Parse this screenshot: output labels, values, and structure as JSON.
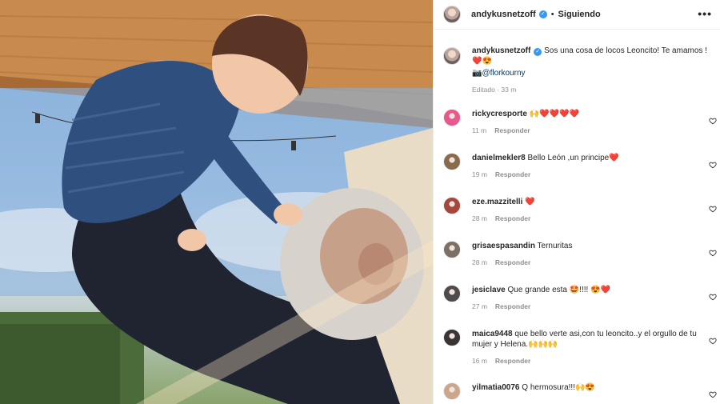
{
  "post": {
    "username": "andykusnetzoff",
    "separator": "•",
    "follow_status": "Siguiendo",
    "more_label": "•••",
    "caption_text": "Sos una cosa de locos Leoncito! Te amamos ! ❤️😍",
    "caption_credit": "📷@flor",
    "caption_credit_mention": "kourny",
    "caption_meta": "Editado · 33 m"
  },
  "comments": [
    {
      "user": "rickycresporte",
      "text": "🙌❤️❤️❤️❤️",
      "time": "11 m",
      "reply": "Responder",
      "avatar_color": "#e7588c"
    },
    {
      "user": "danielmekler8",
      "text": "Bello León ,un principe❤️",
      "time": "19 m",
      "reply": "Responder",
      "avatar_color": "#8a6a4d"
    },
    {
      "user": "eze.mazzitelli",
      "text": "❤️",
      "time": "28 m",
      "reply": "Responder",
      "avatar_color": "#a5473a"
    },
    {
      "user": "grisaespasandin",
      "text": "Ternuritas",
      "time": "28 m",
      "reply": "Responder",
      "avatar_color": "#7c6f66"
    },
    {
      "user": "jesiclave",
      "text": "Que grande esta 🤩!!!! 😍❤️",
      "time": "27 m",
      "reply": "Responder",
      "avatar_color": "#4f4a4c"
    },
    {
      "user": "maica9448",
      "text": "que bello verte asi,con tu leoncito..y el orgullo de tu mujer y Helena.🙌🙌🙌",
      "time": "16 m",
      "reply": "Responder",
      "avatar_color": "#3a3434"
    },
    {
      "user": "yilmatia0076",
      "text": "Q hermosura!!!🙌😍",
      "time": "",
      "reply": "",
      "avatar_color": "#c9a68c"
    }
  ],
  "icons": {
    "verified": "verified-badge-icon",
    "like": "heart-icon",
    "more": "more-options-icon"
  }
}
